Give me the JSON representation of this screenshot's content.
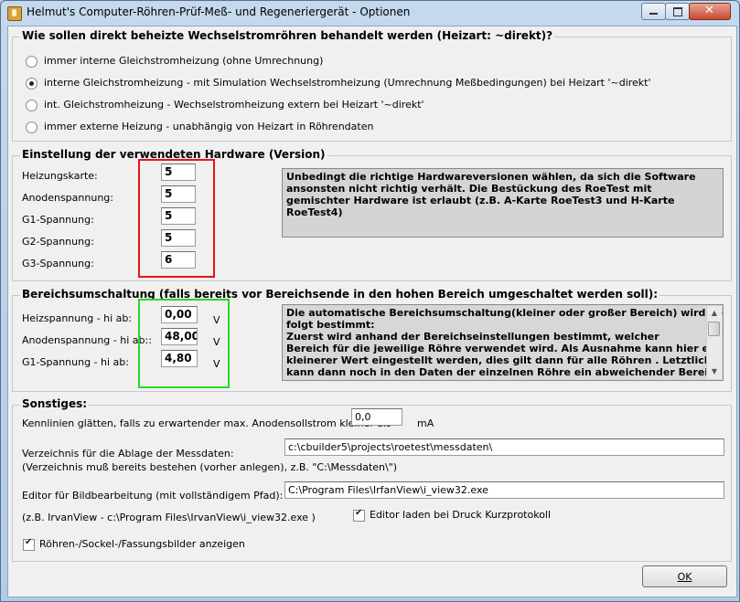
{
  "window": {
    "title": "Helmut's Computer-Röhren-Prüf-Meß- und Regeneriergerät - Optionen"
  },
  "heating": {
    "title": "Wie sollen  direkt beheizte Wechselstromröhren behandelt werden (Heizart: ~direkt)?",
    "options": [
      {
        "label": "immer interne Gleichstromheizung (ohne Umrechnung)",
        "selected": false
      },
      {
        "label": "interne Gleichstromheizung - mit Simulation Wechselstromheizung (Umrechnung Meßbedingungen) bei Heizart '~direkt'",
        "selected": true
      },
      {
        "label": "int. Gleichstromheizung - Wechselstromheizung extern bei Heizart '~direkt'",
        "selected": false
      },
      {
        "label": "immer externe Heizung  - unabhängig von Heizart in Röhrendaten",
        "selected": false
      }
    ]
  },
  "hardware": {
    "title": "Einstellung der  verwendeten Hardware (Version)",
    "fields": [
      {
        "label": "Heizungskarte:",
        "value": "5"
      },
      {
        "label": "Anodenspannung:",
        "value": "5"
      },
      {
        "label": "G1-Spannung:",
        "value": "5"
      },
      {
        "label": "G2-Spannung:",
        "value": "5"
      },
      {
        "label": "G3-Spannung:",
        "value": "6"
      }
    ],
    "note_lines": [
      "Unbedingt die richtige Hardwareversionen wählen, da sich die Software",
      "ansonsten nicht richtig verhält. Die Bestückung des RoeTest mit",
      "gemischter Hardware ist erlaubt (z.B. A-Karte RoeTest3 und H-Karte",
      "RoeTest4)"
    ]
  },
  "range": {
    "title": "Bereichsumschaltung (falls bereits vor Bereichsende in den hohen Bereich umgeschaltet werden soll):",
    "unit": "V",
    "fields": [
      {
        "label": "Heizspannung  - hi ab:",
        "value": "0,00"
      },
      {
        "label": "Anodenspannung - hi ab::",
        "value": "48,00"
      },
      {
        "label": "G1-Spannung - hi ab:",
        "value": "4,80"
      }
    ],
    "note_lines": [
      "Die automatische Bereichsumschaltung(kleiner oder großer Bereich) wird wie",
      "folgt bestimmt:",
      "Zuerst wird anhand der Bereichseinstellungen bestimmt, welcher",
      "Bereich für die jeweilige Röhre  verwendet wird. Als Ausnahme kann hier ein",
      "kleinerer Wert eingestellt werden, dies gilt dann für alle Röhren . Letztlich",
      "kann dann noch in den Daten der einzelnen Röhre ein abweichender Bereich"
    ]
  },
  "misc": {
    "title": "Sonstiges:",
    "smooth_label": "Kennlinien glätten, falls zu erwartender max. Anodensollstrom kleiner als",
    "smooth_value": "0,0",
    "smooth_unit": "mA",
    "dir_label": "Verzeichnis für die Ablage der Messdaten:",
    "dir_value": "c:\\cbuilder5\\projects\\roetest\\messdaten\\",
    "dir_hint": "(Verzeichnis muß bereits bestehen (vorher anlegen), z.B. \"C:\\Messdaten\\\")",
    "editor_label": "Editor für Bildbearbeitung (mit vollständigem Pfad):",
    "editor_value": "C:\\Program Files\\IrfanView\\i_view32.exe",
    "editor_hint": "(z.B. IrvanView - c:\\Program Files\\IrvanView\\i_view32.exe )",
    "editor_checkbox": {
      "label": "Editor laden bei Druck Kurzprotokoll",
      "checked": true
    },
    "images_checkbox": {
      "label": "Röhren-/Sockel-/Fassungsbilder anzeigen",
      "checked": true
    }
  },
  "buttons": {
    "ok": "OK"
  },
  "colors": {
    "highlight_red": "#e8121c",
    "highlight_green": "#2bd62b"
  }
}
